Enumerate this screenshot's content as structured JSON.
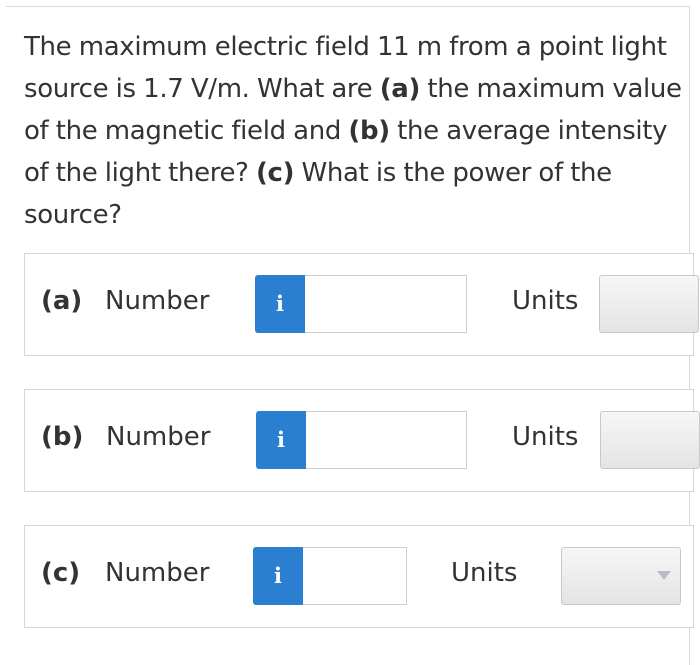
{
  "question": {
    "t1": "The maximum electric field 11 m from a point light source is 1.7 V/m. What are ",
    "a": "(a)",
    "t2": " the maximum value of the magnetic field and ",
    "b": "(b)",
    "t3": " the average intensity of the light there? ",
    "c": "(c)",
    "t4": " What is the power of the source?"
  },
  "parts": [
    {
      "label": "(a)",
      "number_label": "Number",
      "info": "i",
      "value": "",
      "units_label": "Units",
      "units_value": ""
    },
    {
      "label": "(b)",
      "number_label": "Number",
      "info": "i",
      "value": "",
      "units_label": "Units",
      "units_value": ""
    },
    {
      "label": "(c)",
      "number_label": "Number",
      "info": "i",
      "value": "",
      "units_label": "Units",
      "units_value": ""
    }
  ],
  "colors": {
    "info_button": "#2b7fd1",
    "text": "#333333",
    "border": "#d6d6d6"
  }
}
